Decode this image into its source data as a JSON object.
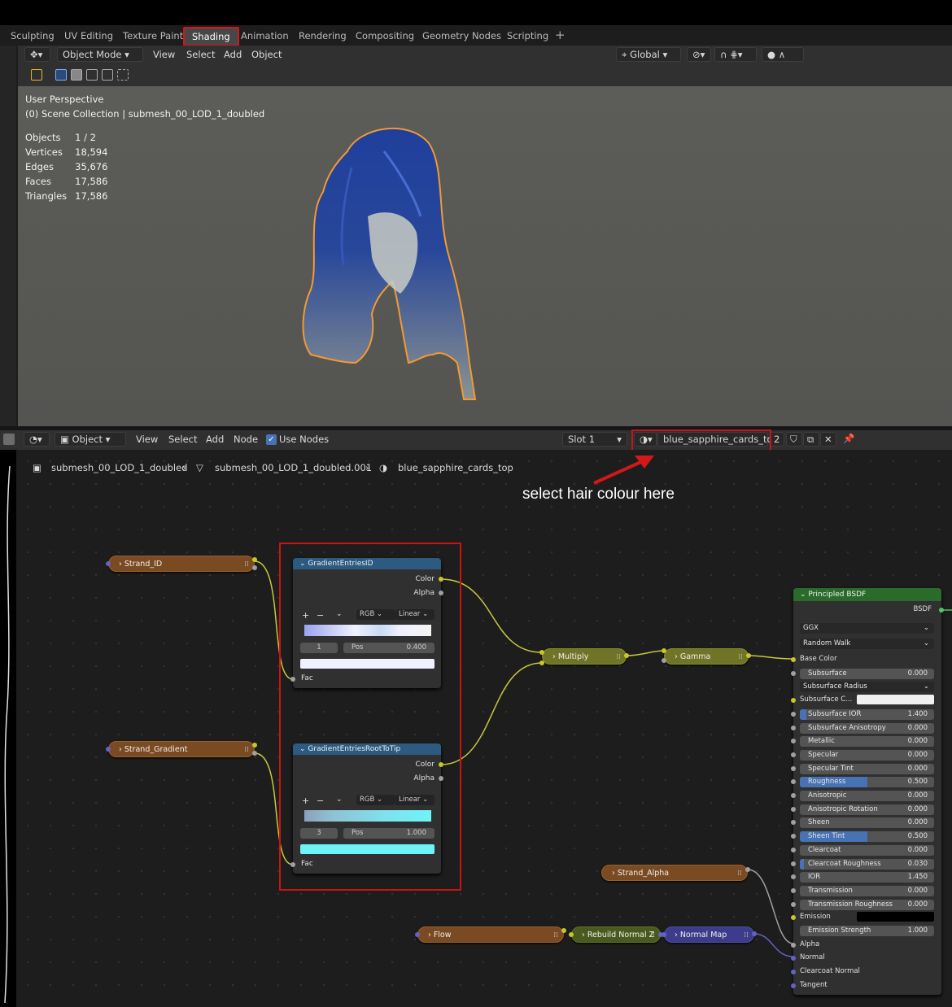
{
  "workspace_tabs": [
    "Sculpting",
    "UV Editing",
    "Texture Paint",
    "Shading",
    "Animation",
    "Rendering",
    "Compositing",
    "Geometry Nodes",
    "Scripting"
  ],
  "active_tab": "Shading",
  "viewport_header": {
    "mode": "Object Mode",
    "menus": [
      "View",
      "Select",
      "Add",
      "Object"
    ],
    "transform_orientation": "Global"
  },
  "viewport": {
    "perspective": "User Perspective",
    "collection": "(0) Scene Collection | submesh_00_LOD_1_doubled",
    "stats": [
      {
        "label": "Objects",
        "value": "1 / 2"
      },
      {
        "label": "Vertices",
        "value": "18,594"
      },
      {
        "label": "Edges",
        "value": "35,676"
      },
      {
        "label": "Faces",
        "value": "17,586"
      },
      {
        "label": "Triangles",
        "value": "17,586"
      }
    ]
  },
  "node_header": {
    "mode": "Object",
    "menus": [
      "View",
      "Select",
      "Add",
      "Node"
    ],
    "use_nodes": "Use Nodes",
    "slot": "Slot 1",
    "material": "blue_sapphire_cards_top",
    "users": "2"
  },
  "breadcrumb": [
    "submesh_00_LOD_1_doubled",
    "submesh_00_LOD_1_doubled.001",
    "blue_sapphire_cards_top"
  ],
  "annotation": "select hair colour here",
  "nodes": {
    "strand_id": "Strand_ID",
    "strand_gradient": "Strand_Gradient",
    "strand_alpha": "Strand_Alpha",
    "flow": "Flow",
    "rebuild_normal": "Rebuild Normal Z",
    "normal_map": "Normal Map",
    "multiply": "Multiply",
    "gamma": "Gamma",
    "ramp1": {
      "title": "GradientEntriesID",
      "color": "Color",
      "alpha": "Alpha",
      "mode": "RGB",
      "interp": "Linear",
      "index": "1",
      "pos_label": "Pos",
      "pos": "0.400",
      "fac": "Fac",
      "swatch": "#f0f1ff"
    },
    "ramp2": {
      "title": "GradientEntriesRootToTip",
      "color": "Color",
      "alpha": "Alpha",
      "mode": "RGB",
      "interp": "Linear",
      "index": "3",
      "pos_label": "Pos",
      "pos": "1.000",
      "fac": "Fac",
      "swatch": "#6ff3f8"
    }
  },
  "principled": {
    "title": "Principled BSDF",
    "output": "BSDF",
    "distribution": "GGX",
    "subsurface_method": "Random Walk",
    "base_color": "Base Color",
    "subsurface_radius": "Subsurface Radius",
    "subsurface_color": "Subsurface C...",
    "fields": [
      {
        "label": "Subsurface",
        "value": "0.000",
        "fill": 0
      },
      {
        "label": "Subsurface IOR",
        "value": "1.400",
        "fill": 0.05
      },
      {
        "label": "Subsurface Anisotropy",
        "value": "0.000",
        "fill": 0
      },
      {
        "label": "Metallic",
        "value": "0.000",
        "fill": 0
      },
      {
        "label": "Specular",
        "value": "0.000",
        "fill": 0
      },
      {
        "label": "Specular Tint",
        "value": "0.000",
        "fill": 0
      },
      {
        "label": "Roughness",
        "value": "0.500",
        "fill": 0.5
      },
      {
        "label": "Anisotropic",
        "value": "0.000",
        "fill": 0
      },
      {
        "label": "Anisotropic Rotation",
        "value": "0.000",
        "fill": 0
      },
      {
        "label": "Sheen",
        "value": "0.000",
        "fill": 0
      },
      {
        "label": "Sheen Tint",
        "value": "0.500",
        "fill": 0.5
      },
      {
        "label": "Clearcoat",
        "value": "0.000",
        "fill": 0
      },
      {
        "label": "Clearcoat Roughness",
        "value": "0.030",
        "fill": 0.03
      },
      {
        "label": "IOR",
        "value": "1.450",
        "fill": 0
      },
      {
        "label": "Transmission",
        "value": "0.000",
        "fill": 0
      },
      {
        "label": "Transmission Roughness",
        "value": "0.000",
        "fill": 0
      }
    ],
    "emission": "Emission",
    "emission_strength": {
      "label": "Emission Strength",
      "value": "1.000"
    },
    "inputs_bottom": [
      "Alpha",
      "Normal",
      "Clearcoat Normal",
      "Tangent"
    ]
  },
  "colors": {
    "highlight": "#c81414",
    "accent": "#4772b3"
  }
}
